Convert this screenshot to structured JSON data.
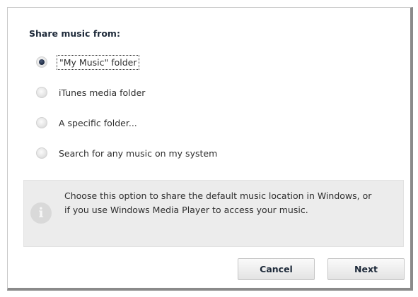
{
  "heading": "Share music from:",
  "options": [
    {
      "label": "\"My Music\" folder",
      "selected": true
    },
    {
      "label": "iTunes media folder",
      "selected": false
    },
    {
      "label": "A specific folder...",
      "selected": false
    },
    {
      "label": "Search for any music on my system",
      "selected": false
    }
  ],
  "info": {
    "icon": "info-icon",
    "glyph": "i",
    "text": "Choose this option to share the default music location in Windows, or if you use Windows Media Player to access your music."
  },
  "buttons": {
    "cancel_label": "Cancel",
    "next_label": "Next"
  }
}
